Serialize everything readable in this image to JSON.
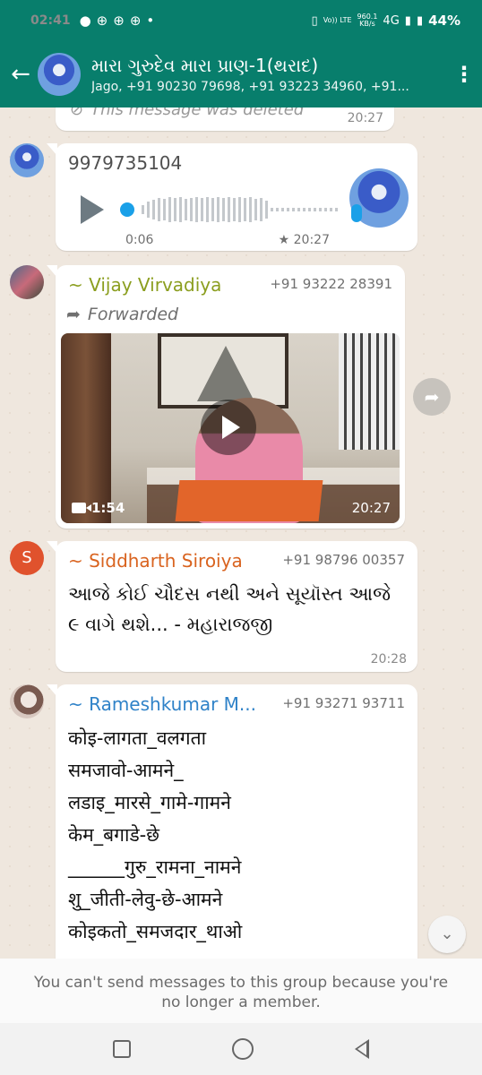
{
  "status_bar": {
    "time": "02:41",
    "left_icons": [
      "chat-bubble-icon",
      "game-icon",
      "game-icon",
      "game-icon",
      "dot-icon"
    ],
    "vibrate_icon": "vibrate-icon",
    "volte": "Vo)) LTE",
    "speed": "960.1",
    "speed_unit": "KB/s",
    "network": "4G",
    "battery": "44%"
  },
  "app_bar": {
    "group_name": "મારા ગુરુદેવ મારા પ્રાણ-1(થરાદ)",
    "members": "Jago, +91 90230 79698, +91 93223 34960, +91...",
    "back_icon": "back-arrow-icon",
    "menu_icon": "more-vert-icon"
  },
  "messages": [
    {
      "type": "deleted",
      "text": "This message was deleted",
      "time": "20:27"
    },
    {
      "type": "voice",
      "sender": "9979735104",
      "duration": "0:06",
      "time": "20:27",
      "starred": true
    },
    {
      "type": "video",
      "sender": "~ Vijay Virvadiya",
      "phone": "+91 93222 28391",
      "forwarded": "Forwarded",
      "duration": "1:54",
      "time": "20:27"
    },
    {
      "type": "text",
      "avatar_letter": "S",
      "sender": "~ Siddharth Siroiya",
      "phone": "+91 98796 00357",
      "body": "આજે કોઈ ચૌદસ નથી અને સૂયૉસ્ત આજે ૯ વાગે થશે... - મહારાજજી",
      "time": "20:28"
    },
    {
      "type": "text",
      "sender": "~ Rameshkumar M...",
      "phone": "+91 93271 93711",
      "lines": [
        "कोइ-लागता_वलगता",
        "समजावो-आमने_",
        "लडाइ_मारसे_गामे-गामने",
        "केम_बगाडे-छे",
        "______गुरु_रामना_नामने",
        "शु_जीती-लेवु-छे-आमने",
        "कोइकतो_समजदार_थाओ"
      ]
    }
  ],
  "footer": {
    "notice": "You can't send messages to this group because you're no longer a member."
  },
  "colors": {
    "header": "#087e6c",
    "chat_bg": "#efe7de",
    "sender_vijay": "#8b9e1f",
    "sender_siddharth": "#d9631f",
    "sender_ramesh": "#2f82c8"
  }
}
